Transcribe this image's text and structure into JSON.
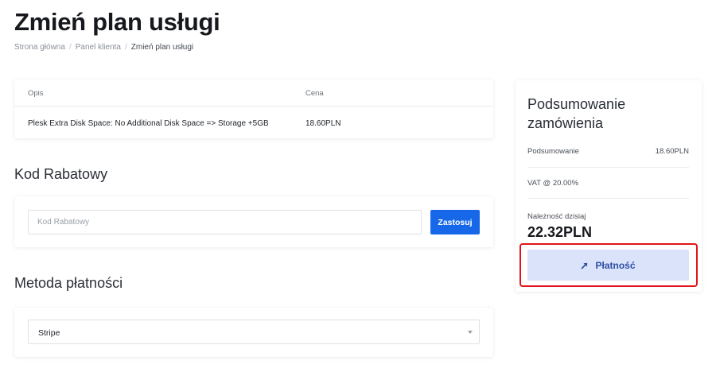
{
  "page": {
    "title": "Zmień plan usługi",
    "breadcrumb": [
      "Strona główna",
      "Panel klienta",
      "Zmień plan usługi"
    ]
  },
  "items_table": {
    "headers": [
      "Opis",
      "Cena"
    ],
    "rows": [
      {
        "description": "Plesk Extra Disk Space: No Additional Disk Space => Storage +5GB",
        "price": "18.60PLN"
      }
    ]
  },
  "coupon": {
    "section_title": "Kod Rabatowy",
    "placeholder": "Kod Rabatowy",
    "value": "",
    "apply_label": "Zastosuj"
  },
  "payment": {
    "section_title": "Metoda płatności",
    "selected": "Stripe"
  },
  "summary": {
    "title": "Podsumowanie zamówienia",
    "subtotal_label": "Podsumowanie",
    "subtotal_value": "18.60PLN",
    "vat_label": "VAT @ 20.00%",
    "due_label": "Należność dzisiaj",
    "due_amount": "22.32PLN",
    "pay_label": "Płatność",
    "pay_icon": "arrow-right-icon"
  },
  "colors": {
    "primary": "#1768e8",
    "pay_button_bg": "#dbe3fb",
    "pay_button_text": "#2c4ea3",
    "highlight": "#e0141a"
  }
}
